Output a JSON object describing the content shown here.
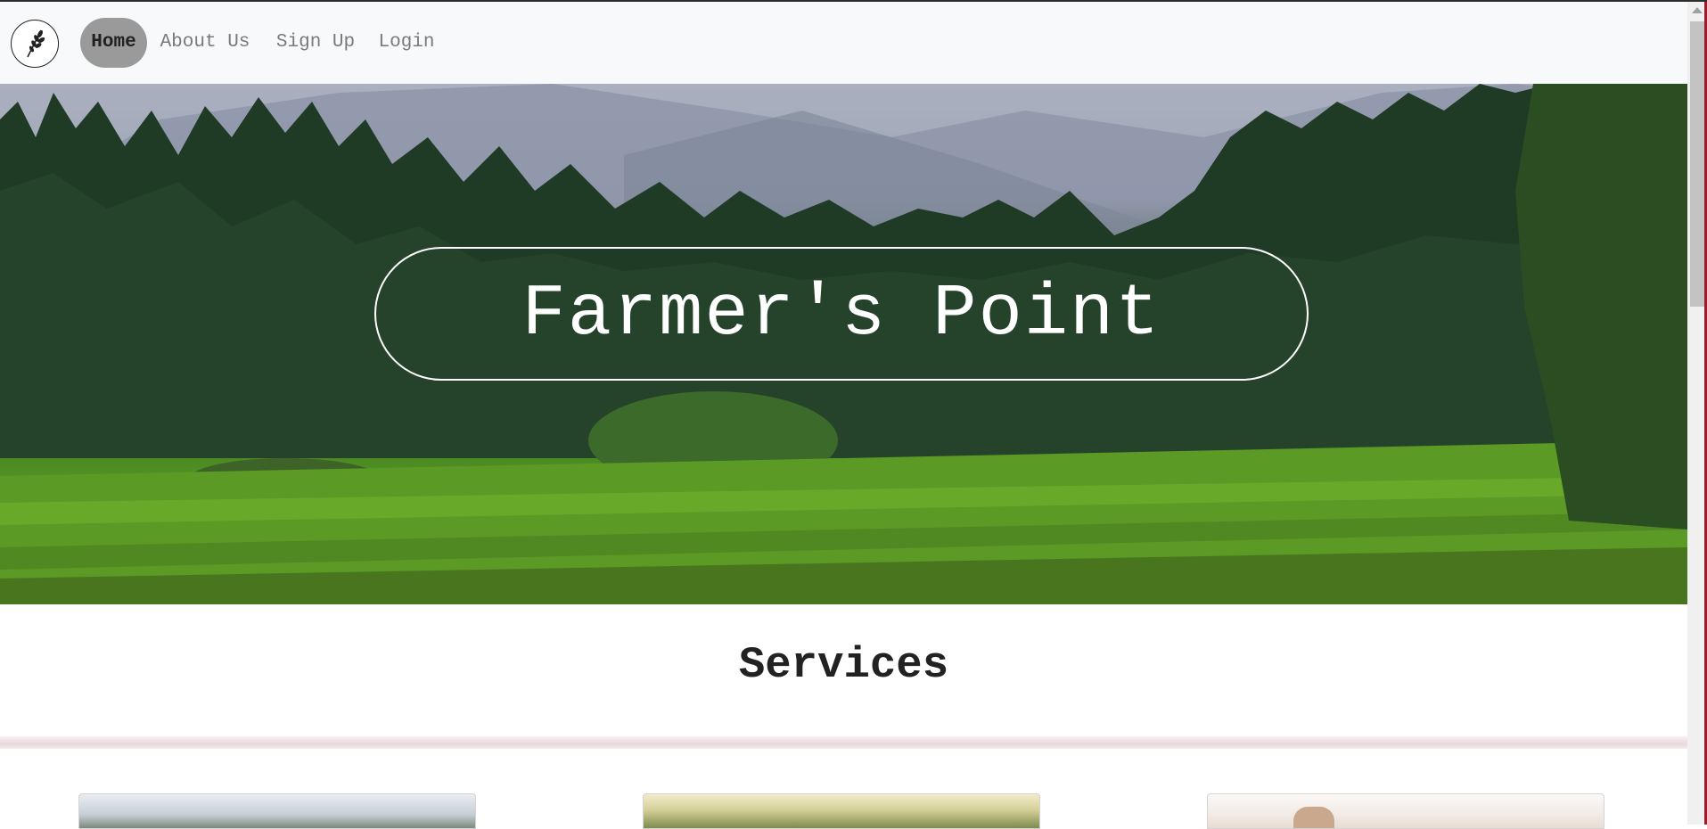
{
  "navbar": {
    "logo_icon": "wheat-icon",
    "links": [
      {
        "label": "Home",
        "active": true
      },
      {
        "label": "About Us",
        "active": false
      },
      {
        "label": "Sign Up",
        "active": false
      },
      {
        "label": "Login",
        "active": false
      }
    ]
  },
  "hero": {
    "title": "Farmer's Point"
  },
  "services": {
    "heading": "Services"
  },
  "colors": {
    "active_pill": "#9a9a9a",
    "navbar_bg": "#f8f9fa",
    "accent_edge": "#9b1c2b"
  }
}
